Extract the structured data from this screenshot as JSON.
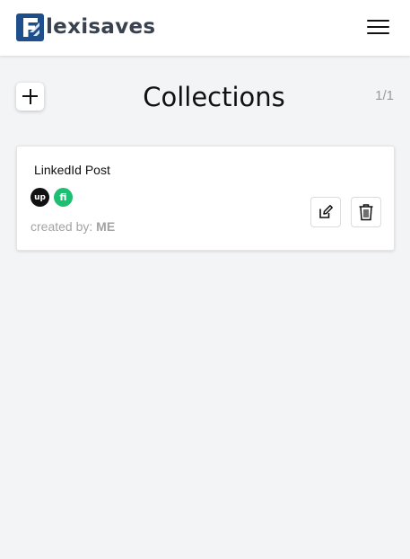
{
  "app": {
    "brand_name": "lexisaves",
    "brand_color": "#1f4e8c"
  },
  "header": {
    "menu_icon": "hamburger-menu-icon"
  },
  "collections": {
    "title": "Collections",
    "page_indicator": "1/1",
    "add_icon": "plus-icon",
    "items": [
      {
        "name": "LinkedId Post",
        "platform_icons": [
          {
            "name": "upwork-icon",
            "glyph": "up",
            "color": "#111111"
          },
          {
            "name": "fiverr-icon",
            "glyph": "fi",
            "color": "#1dbf73"
          }
        ],
        "created_by_label": "created by:",
        "created_by_value": "ME",
        "edit_icon": "pencil-square-icon",
        "delete_icon": "trash-icon"
      }
    ]
  }
}
